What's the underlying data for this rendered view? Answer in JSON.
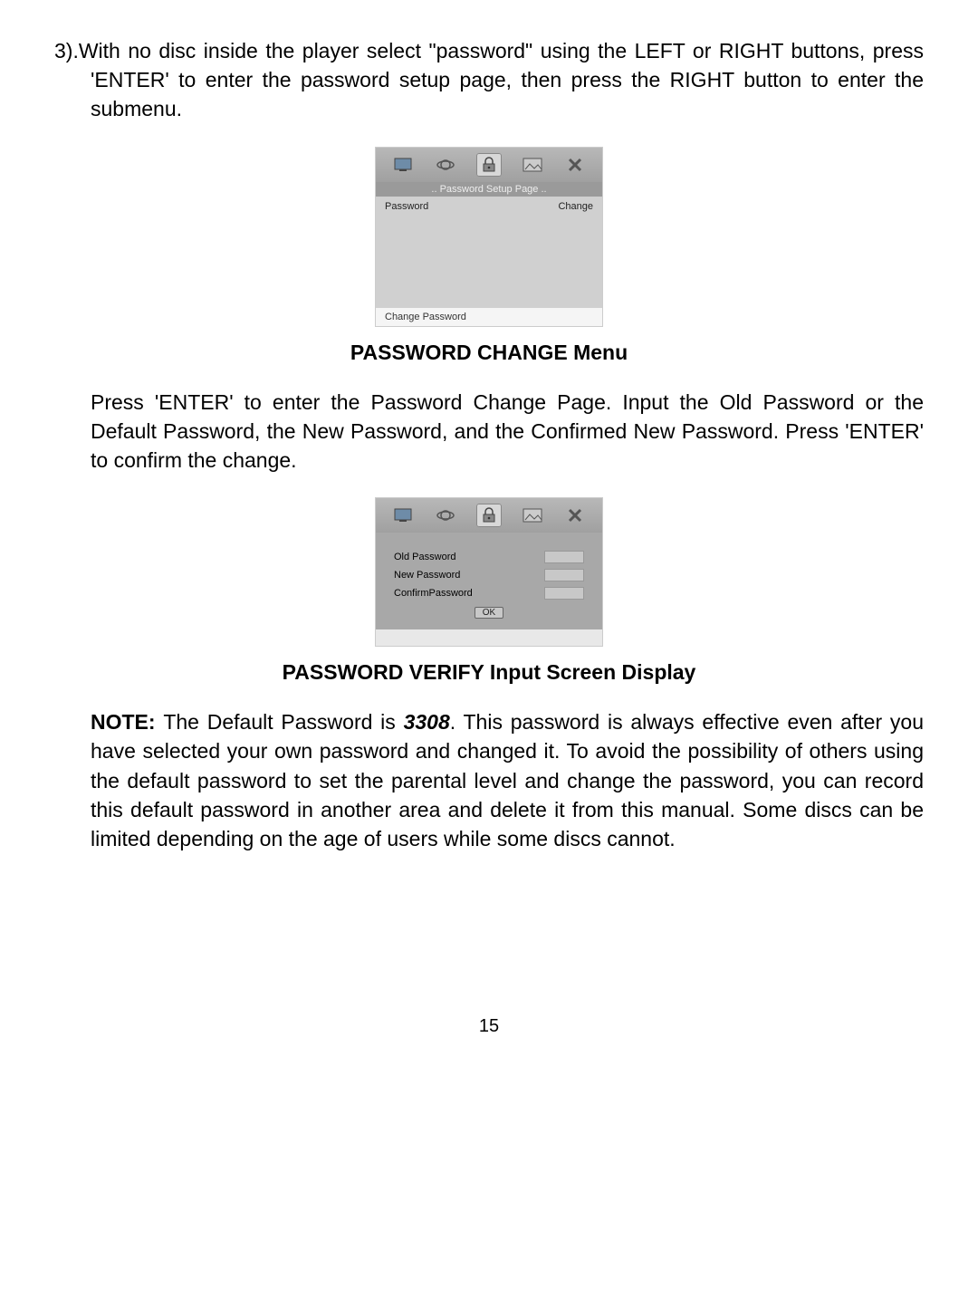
{
  "step3": "3).With no disc inside the player select \"password\" using the LEFT or RIGHT buttons, press 'ENTER' to enter the password setup page, then press the RIGHT button to enter the submenu.",
  "screenshot1": {
    "title": "..  Password  Setup  Page  ..",
    "row_label": "Password",
    "row_value": "Change",
    "footer": "Change  Password"
  },
  "caption1": "PASSWORD CHANGE Menu",
  "para1": "Press 'ENTER' to enter the Password Change Page. Input the Old Pass­word or the Default Password, the New Password, and the Confirmed New Password. Press 'ENTER' to confirm the change.",
  "screenshot2": {
    "old": "Old  Password",
    "new": "New  Password",
    "confirm": "ConfirmPassword",
    "ok": "OK"
  },
  "caption2": "PASSWORD VERIFY Input Screen Display",
  "note_label": "NOTE: ",
  "note_pre": "The Default Password is ",
  "note_pw": "3308",
  "note_post": ".  This password  is always effec­tive even after you have selected your own password  and changed it. To avoid the possibility of others using the default password to set the parental level and change the password, you can record this default password in another area and delete it from this manual. Some discs can be limited depending on the age of users while some discs cannot.",
  "page": "15"
}
